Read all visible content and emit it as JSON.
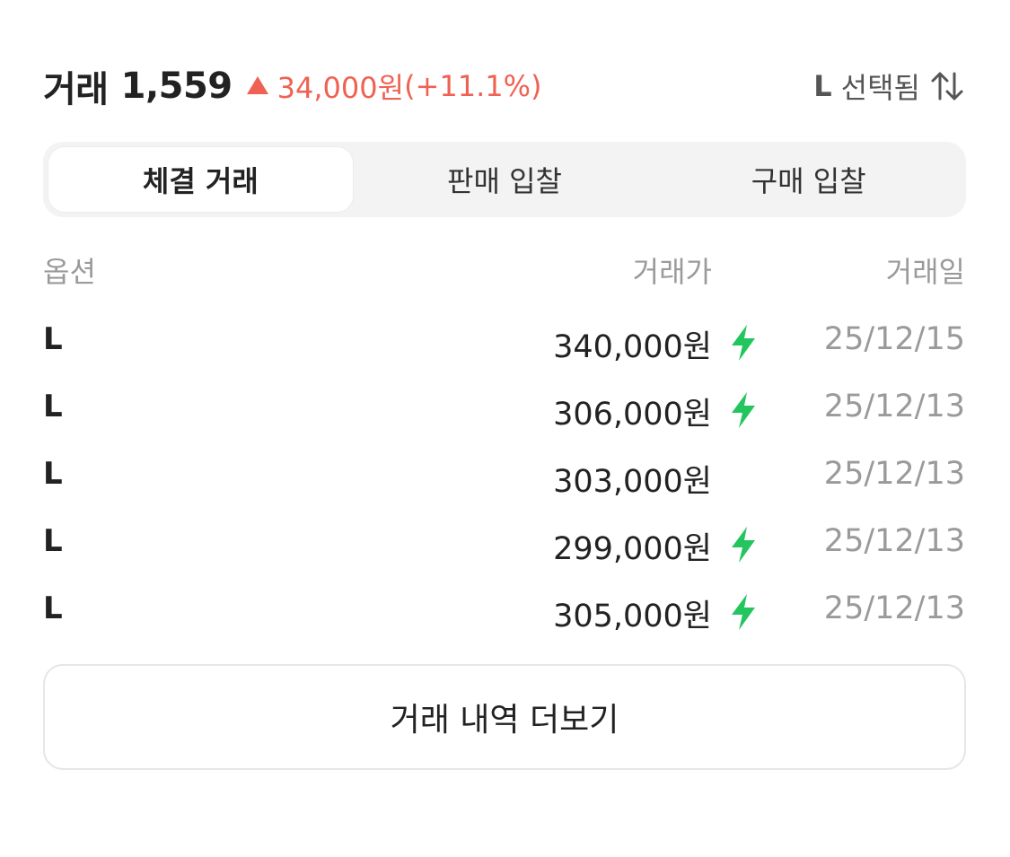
{
  "header": {
    "title": "거래",
    "count": "1,559",
    "change_amount": "34,000원",
    "change_percent": "(+11.1%)",
    "up_icon": "triangle-up-icon",
    "size_filter": "L",
    "size_filter_label": "선택됨",
    "sort_icon": "sort-arrows-icon"
  },
  "tabs": [
    {
      "label": "체결 거래",
      "active": true
    },
    {
      "label": "판매 입찰",
      "active": false
    },
    {
      "label": "구매 입찰",
      "active": false
    }
  ],
  "table": {
    "columns": [
      "옵션",
      "거래가",
      "거래일"
    ],
    "rows": [
      {
        "option": "L",
        "price": "340,000원",
        "fast": true,
        "date": "25/12/15"
      },
      {
        "option": "L",
        "price": "306,000원",
        "fast": true,
        "date": "25/12/13"
      },
      {
        "option": "L",
        "price": "303,000원",
        "fast": false,
        "date": "25/12/13"
      },
      {
        "option": "L",
        "price": "299,000원",
        "fast": true,
        "date": "25/12/13"
      },
      {
        "option": "L",
        "price": "305,000원",
        "fast": true,
        "date": "25/12/13"
      }
    ],
    "fast_icon": "lightning-bolt-icon"
  },
  "more_button": "거래 내역 더보기",
  "colors": {
    "rise": "#ef6253",
    "fast": "#22c55e",
    "muted": "#9a9a9a"
  }
}
